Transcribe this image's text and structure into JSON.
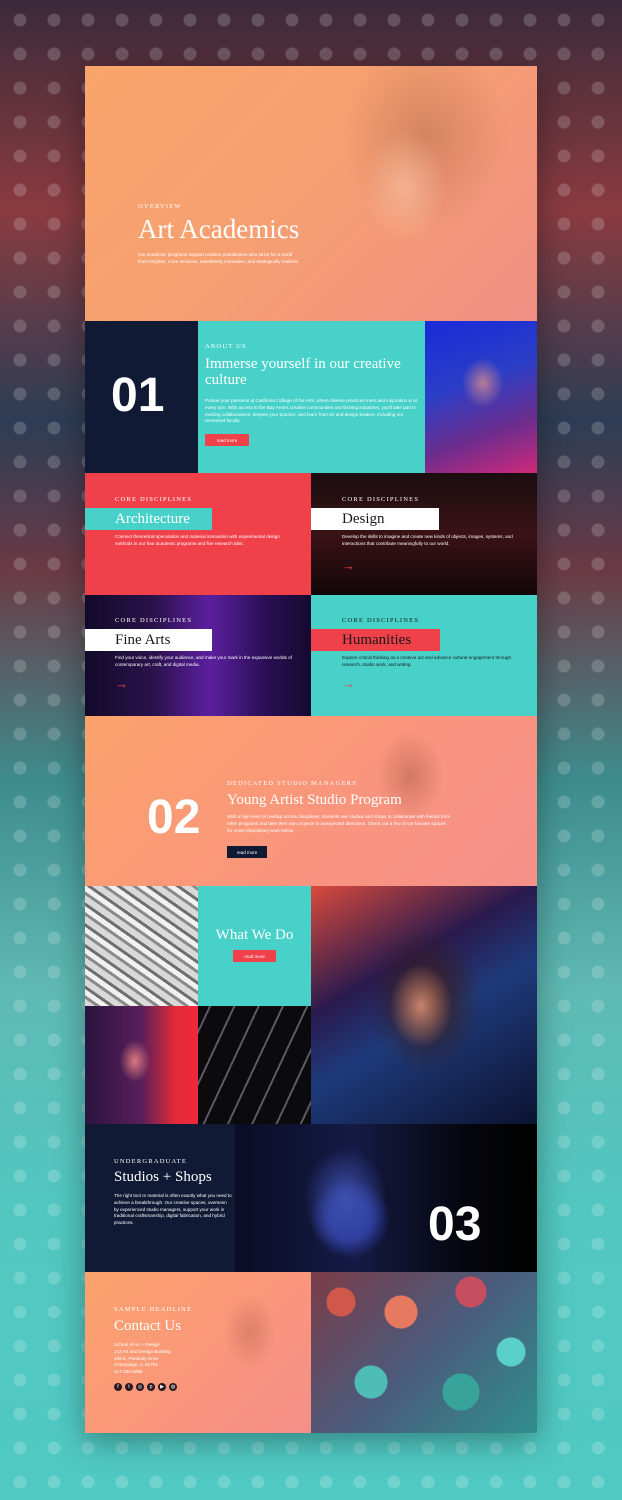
{
  "hero": {
    "kicker": "Overview",
    "title": "Art Academics",
    "text": "Our academic programs support creative practitioners who strive for a world that's brighter, more inclusive, relentlessly innovative, and strategically resilient."
  },
  "about": {
    "number": "01",
    "kicker": "About Us",
    "title": "Immerse yourself in our creative culture",
    "text": "Pursue your passions at California College of the Arts, where diverse practices meet and inspiration is at every turn. With access to the Bay Area's creative communities and thriving industries, you'll take part in exciting collaborations, deepen your practice, and learn from art and design leaders, including our renowned faculty.",
    "button": "read more"
  },
  "disciplines": [
    {
      "kicker": "Core Disciplines",
      "title": "Architecture",
      "text": "Connect theoretical speculation and material innovation with experimental design methods in our four academic programs and five research labs."
    },
    {
      "kicker": "Core Disciplines",
      "title": "Design",
      "text": "Develop the skills to imagine and create new kinds of objects, images, systems, and interactions that contribute meaningfully to our world."
    },
    {
      "kicker": "Core Disciplines",
      "title": "Fine Arts",
      "text": "Find your voice, identify your audience, and make your mark in the expansive worlds of contemporary art, craft, and digital media."
    },
    {
      "kicker": "Core Disciplines",
      "title": "Humanities",
      "text": "Explore critical thinking as a creative act and advance cultural engagement through research, studio work, and writing."
    }
  ],
  "studio": {
    "number": "02",
    "kicker": "Dedicated Studio Managers",
    "title": "Young Artist Studio Program",
    "text": "With a high level of overlap across disciplines, students use studios and shops to collaborate with friends from other programs and take their own projects in unexpected directions. Check out a few of our favorite spaces for cross-disciplinary work below.",
    "button": "read more"
  },
  "what": {
    "title": "What We Do",
    "button": "read more"
  },
  "undergrad": {
    "number": "03",
    "kicker": "Undergraduate",
    "title": "Studios + Shops",
    "text": "The right tool or material is often exactly what you need to achieve a breakthrough. Our creative spaces, overseen by experienced studio managers, support your work in traditional craftsmanship, digital fabrication, and hybrid practices."
  },
  "contact": {
    "kicker": "Sample Headline",
    "title": "Contact Us",
    "lines": [
      "School of Art + Design",
      "142 Art and Design Building",
      "408 E. Peabody Drive",
      "Champaign, IL 61792",
      "217-333-6865"
    ],
    "social": [
      {
        "icon": "facebook-icon",
        "glyph": "f"
      },
      {
        "icon": "twitter-icon",
        "glyph": "t"
      },
      {
        "icon": "instagram-icon",
        "glyph": "◎"
      },
      {
        "icon": "pinterest-icon",
        "glyph": "p"
      },
      {
        "icon": "youtube-icon",
        "glyph": "▶"
      },
      {
        "icon": "dribbble-icon",
        "glyph": "◍"
      }
    ]
  },
  "colors": {
    "teal": "#47d1c9",
    "coral": "#f0414b",
    "navy": "#101a35",
    "peach": "#f9a56a"
  }
}
